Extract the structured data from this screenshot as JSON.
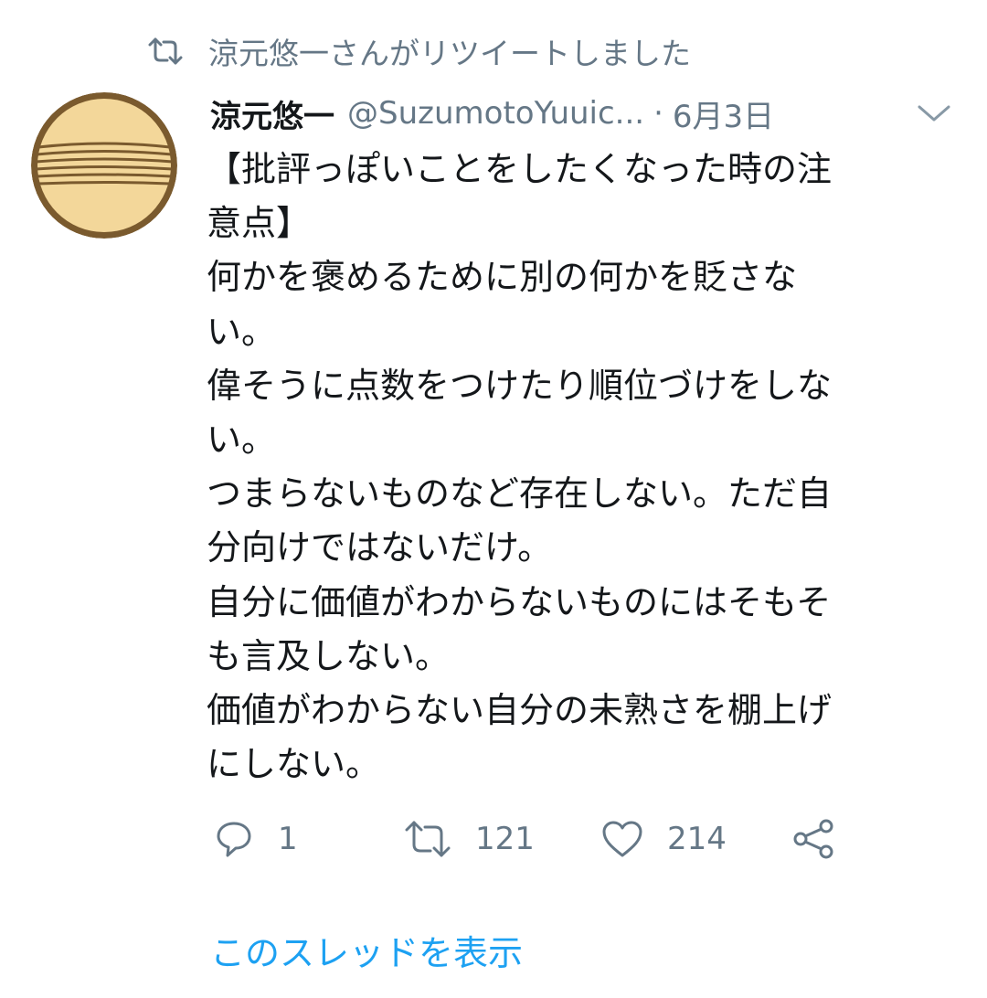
{
  "retweet_banner": {
    "icon": "retweet-icon",
    "text": "涼元悠一さんがリツイートしました"
  },
  "tweet": {
    "author_name": "涼元悠一",
    "handle": "@SuzumotoYuuic...",
    "separator": "·",
    "date": "6月3日",
    "menu_icon": "chevron-down-icon",
    "text_lines": [
      "【批評っぽいことをしたくなった時の注",
      "意点】",
      "何かを褒めるために別の何かを貶さな",
      "い。",
      "偉そうに点数をつけたり順位づけをしな",
      "い。",
      "つまらないものなど存在しない。ただ自",
      "分向けではないだけ。",
      "自分に価値がわからないものにはそもそ",
      "も言及しない。",
      "価値がわからない自分の未熟さを棚上げ",
      "にしない。"
    ],
    "actions": {
      "reply": {
        "icon": "reply-icon",
        "count": "1"
      },
      "retweet": {
        "icon": "retweet-icon",
        "count": "121"
      },
      "like": {
        "icon": "heart-icon",
        "count": "214"
      },
      "share": {
        "icon": "share-icon"
      }
    },
    "show_thread": "このスレッドを表示"
  },
  "colors": {
    "text_primary": "#14171a",
    "text_secondary": "#657786",
    "link": "#1da1f2",
    "avatar_dark": "#7a5a2e",
    "avatar_light": "#f3d79a"
  }
}
